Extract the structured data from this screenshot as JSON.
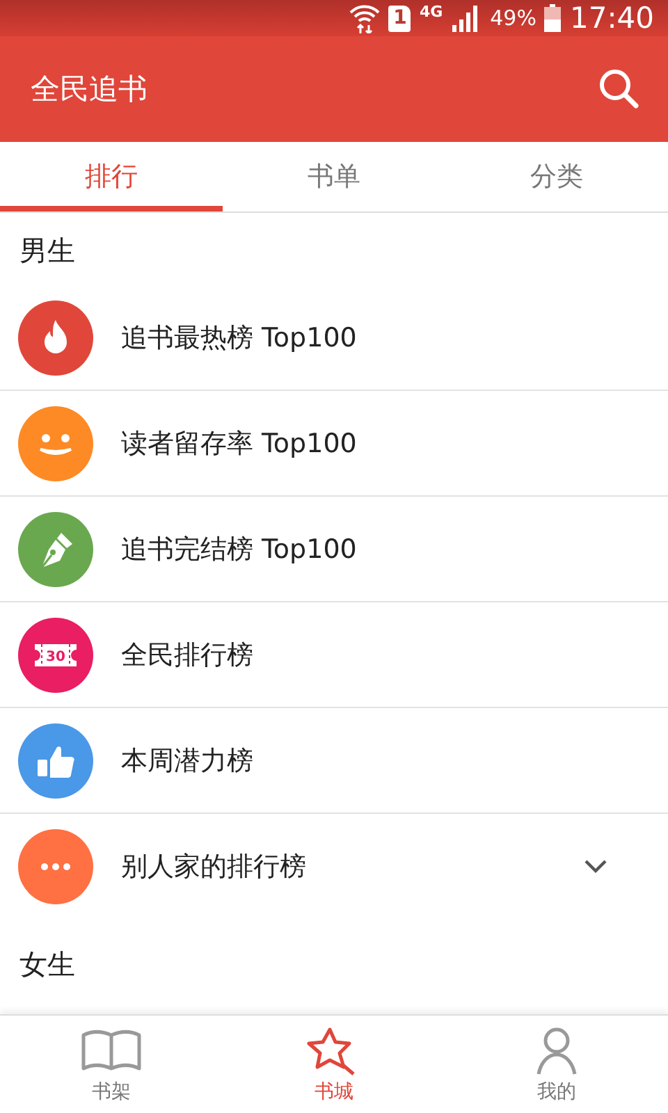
{
  "status_bar": {
    "sim_label": "1",
    "network": "4G",
    "battery": "49%",
    "time": "17:40"
  },
  "app_bar": {
    "title": "全民追书"
  },
  "tabs": [
    {
      "label": "排行",
      "selected": true
    },
    {
      "label": "书单",
      "selected": false
    },
    {
      "label": "分类",
      "selected": false
    }
  ],
  "sections": [
    {
      "title": "男生",
      "items": [
        {
          "label": "追书最热榜 Top100",
          "kind": "fire",
          "color": "#e0473a",
          "expandable": false
        },
        {
          "label": "读者留存率 Top100",
          "kind": "smile",
          "color": "#fe8a25",
          "expandable": false
        },
        {
          "label": "追书完结榜 Top100",
          "kind": "pen",
          "color": "#6aa84f",
          "expandable": false
        },
        {
          "label": "全民排行榜",
          "kind": "ticket",
          "icon_text": "30",
          "color": "#e91e63",
          "expandable": false
        },
        {
          "label": "本周潜力榜",
          "kind": "thumb",
          "color": "#4a98e8",
          "expandable": false
        },
        {
          "label": "别人家的排行榜",
          "kind": "more",
          "color": "#ff7043",
          "expandable": true
        }
      ]
    },
    {
      "title": "女生"
    }
  ],
  "bottom_nav": [
    {
      "label": "书架",
      "kind": "book",
      "selected": false
    },
    {
      "label": "书城",
      "kind": "star",
      "selected": true
    },
    {
      "label": "我的",
      "kind": "person",
      "selected": false
    }
  ]
}
